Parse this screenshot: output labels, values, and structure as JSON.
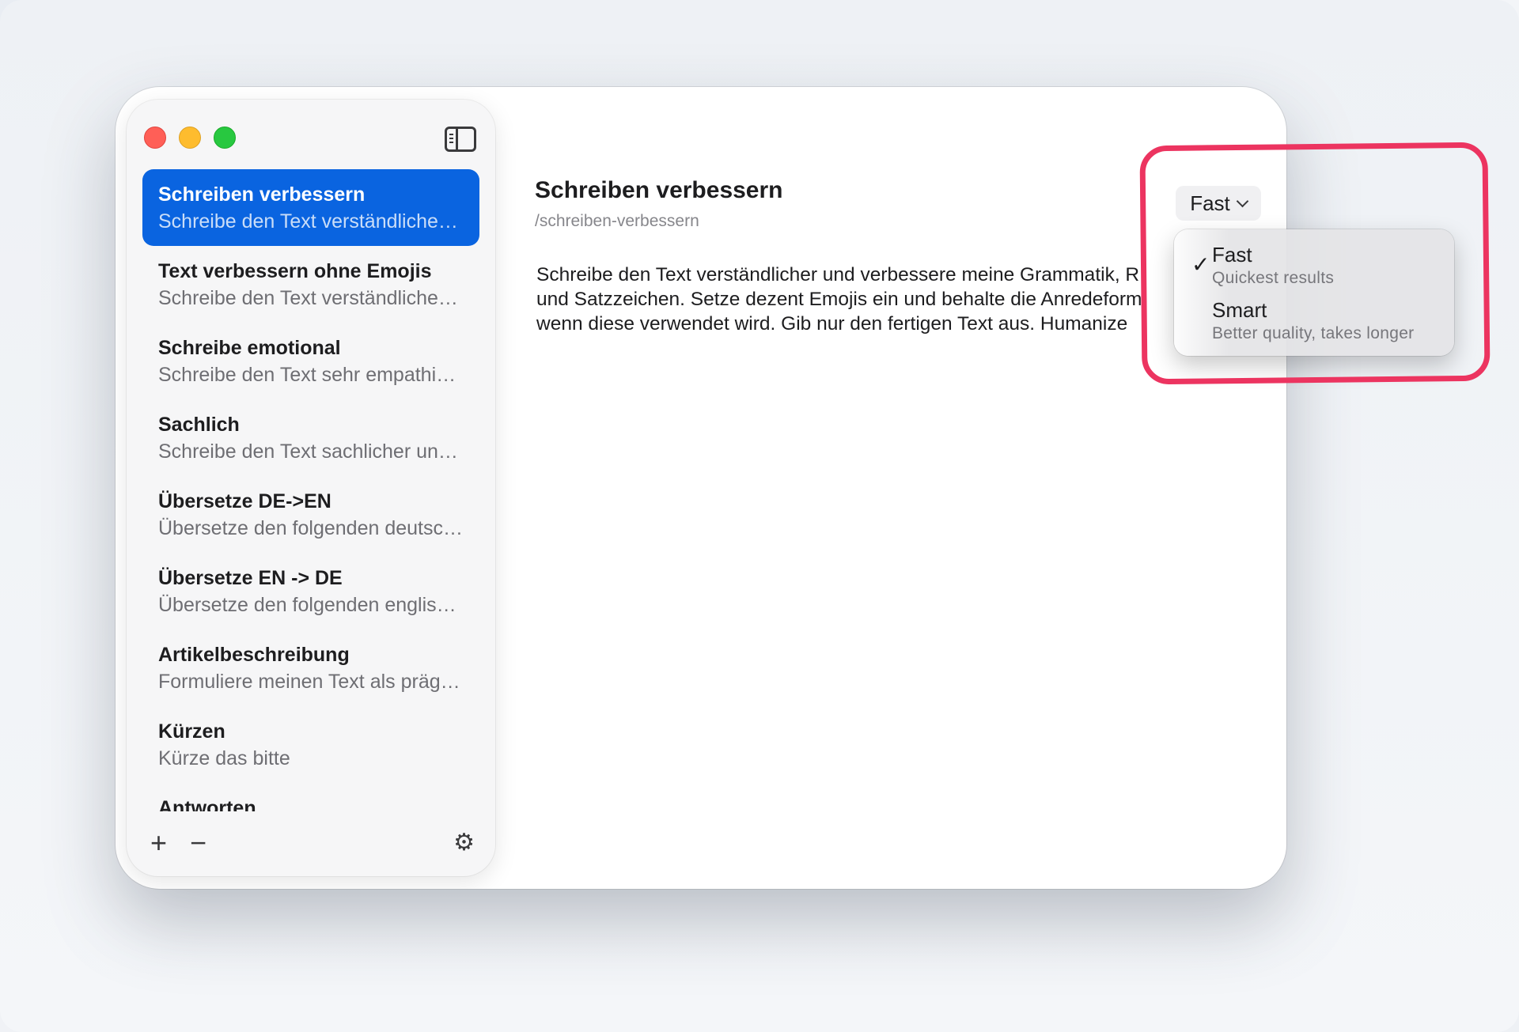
{
  "sidebar": {
    "items": [
      {
        "title": "Schreiben verbessern",
        "subtitle": "Schreibe den Text verständlicher und verbessere meine Grammatik",
        "selected": true
      },
      {
        "title": "Text verbessern ohne Emojis",
        "subtitle": "Schreibe den Text verständlicher und verbessere",
        "selected": false
      },
      {
        "title": "Schreibe emotional",
        "subtitle": "Schreibe den Text sehr empathisch und emotional",
        "selected": false
      },
      {
        "title": "Sachlich",
        "subtitle": "Schreibe den Text sachlicher und neutraler",
        "selected": false
      },
      {
        "title": "Übersetze DE->EN",
        "subtitle": "Übersetze den folgenden deutschen Text",
        "selected": false
      },
      {
        "title": "Übersetze EN -> DE",
        "subtitle": "Übersetze den folgenden englischen Text",
        "selected": false
      },
      {
        "title": "Artikelbeschreibung",
        "subtitle": "Formuliere meinen Text als prägnante",
        "selected": false
      },
      {
        "title": "Kürzen",
        "subtitle": "Kürze das bitte",
        "selected": false
      },
      {
        "title": "Antworten",
        "subtitle": "",
        "selected": false
      }
    ],
    "footer": {
      "add": "+",
      "remove": "−",
      "settings": "⚙"
    }
  },
  "main": {
    "title": "Schreiben verbessern",
    "slug": "/schreiben-verbessern",
    "body": "Schreibe den Text verständlicher und verbessere meine Grammatik, R\nund Satzzeichen. Setze dezent Emojis ein und behalte die Anredeform\nwenn diese verwendet wird. Gib nur den fertigen Text aus. Humanize"
  },
  "model_selector": {
    "selected": "Fast",
    "options": [
      {
        "label": "Fast",
        "description": "Quickest results",
        "checked": true
      },
      {
        "label": "Smart",
        "description": "Better quality, takes longer",
        "checked": false
      }
    ]
  },
  "colors": {
    "accent": "#0a64e0",
    "highlight": "#ec3460"
  }
}
